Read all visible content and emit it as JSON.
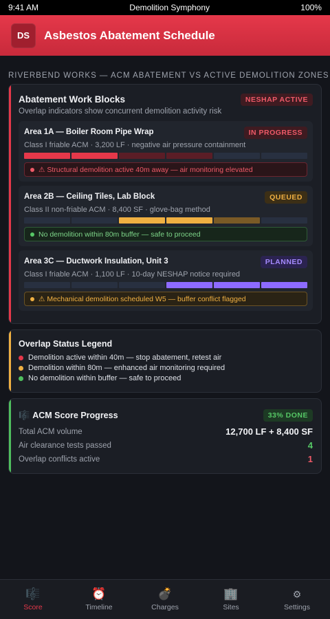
{
  "status_bar": {
    "time": "9:41 AM",
    "carrier": "Demolition Symphony",
    "battery": "100%"
  },
  "header": {
    "avatar_initials": "DS",
    "title": "Asbestos Abatement Schedule"
  },
  "section_label": "RIVERBEND WORKS — ACM ABATEMENT VS ACTIVE DEMOLITION ZONES",
  "work_blocks": {
    "title": "Abatement Work Blocks",
    "subtitle": "Overlap indicators show concurrent demolition activity risk",
    "badge": "NESHAP ACTIVE",
    "areas": [
      {
        "title": "Area 1A — Boiler Room Pipe Wrap",
        "detail": "Class I friable ACM · 3,200 LF · negative air pressure containment",
        "status": "IN PROGRESS",
        "segments": [
          "red",
          "red",
          "darkred",
          "darkred",
          "empty",
          "empty"
        ],
        "alert": "⚠ Structural demolition active 40m away — air monitoring elevated",
        "alert_level": "red"
      },
      {
        "title": "Area 2B — Ceiling Tiles, Lab Block",
        "detail": "Class II non-friable ACM · 8,400 SF · glove-bag method",
        "status": "QUEUED",
        "segments": [
          "empty",
          "empty",
          "amber",
          "amber",
          "darkamber",
          "empty"
        ],
        "alert": "No demolition within 80m buffer — safe to proceed",
        "alert_level": "green"
      },
      {
        "title": "Area 3C — Ductwork Insulation, Unit 3",
        "detail": "Class I friable ACM · 1,100 LF · 10-day NESHAP notice required",
        "status": "PLANNED",
        "segments": [
          "empty",
          "empty",
          "empty",
          "purple",
          "purple",
          "purple"
        ],
        "alert": "⚠ Mechanical demolition scheduled W5 — buffer conflict flagged",
        "alert_level": "amber"
      }
    ]
  },
  "legend": {
    "title": "Overlap Status Legend",
    "items": [
      {
        "label": "Demolition active within 40m — stop abatement, retest air",
        "color": "#e5384a"
      },
      {
        "label": "Demolition within 80m — enhanced air monitoring required",
        "color": "#f0b042"
      },
      {
        "label": "No demolition within buffer — safe to proceed",
        "color": "#4fbf5e"
      }
    ]
  },
  "progress": {
    "icon": "music-score-icon",
    "title": "ACM Score Progress",
    "badge": "33% DONE",
    "stats": [
      {
        "label": "Total ACM volume",
        "value": "12,700 LF + 8,400 SF"
      },
      {
        "label": "Air clearance tests passed",
        "value": "4"
      },
      {
        "label": "Overlap conflicts active",
        "value": "1"
      }
    ]
  },
  "tabs": [
    {
      "label": "Score",
      "icon": "🎼"
    },
    {
      "label": "Timeline",
      "icon": "⏰"
    },
    {
      "label": "Charges",
      "icon": "💣"
    },
    {
      "label": "Sites",
      "icon": "🏢"
    },
    {
      "label": "Settings",
      "icon": "⚙"
    }
  ],
  "colors": {
    "accent": "#e5384a",
    "amber": "#f0b042",
    "green": "#4fbf5e",
    "purple": "#8d6bff",
    "background": "#13151b",
    "card": "#1b1e25"
  }
}
